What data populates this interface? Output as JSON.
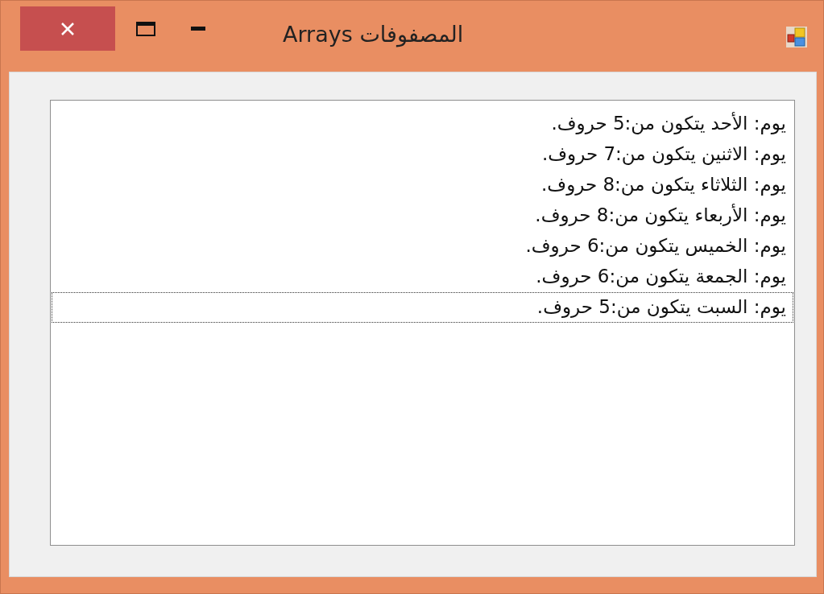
{
  "window": {
    "title": "المصفوفات Arrays"
  },
  "list": {
    "items": [
      {
        "text": "يوم: الأحد يتكون من:5 حروف.",
        "selected": false
      },
      {
        "text": "يوم: الاثنين يتكون من:7 حروف.",
        "selected": false
      },
      {
        "text": "يوم: الثلاثاء يتكون من:8 حروف.",
        "selected": false
      },
      {
        "text": "يوم: الأربعاء يتكون من:8 حروف.",
        "selected": false
      },
      {
        "text": "يوم: الخميس يتكون من:6 حروف.",
        "selected": false
      },
      {
        "text": "يوم: الجمعة يتكون من:6 حروف.",
        "selected": false
      },
      {
        "text": "يوم: السبت يتكون من:5 حروف.",
        "selected": true
      }
    ]
  }
}
